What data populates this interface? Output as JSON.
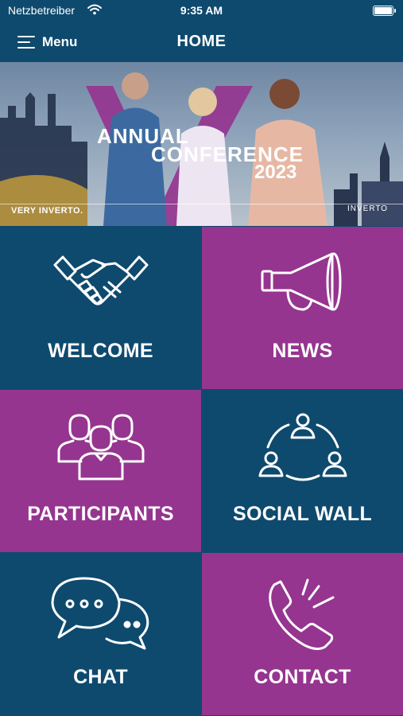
{
  "status_bar": {
    "carrier": "Netzbetreiber",
    "time": "9:35 AM"
  },
  "nav": {
    "menu_label": "Menu",
    "title": "HOME"
  },
  "banner": {
    "line1": "ANNUAL",
    "line2": "CONFERENCE",
    "line3": "2023",
    "tagline": "VERY INVERTO.",
    "brand": "INVERTO"
  },
  "tiles": [
    {
      "label": "WELCOME",
      "icon": "handshake-icon",
      "color": "#0e4a6e"
    },
    {
      "label": "NEWS",
      "icon": "megaphone-icon",
      "color": "#95358f"
    },
    {
      "label": "PARTICIPANTS",
      "icon": "participants-icon",
      "color": "#95358f"
    },
    {
      "label": "SOCIAL WALL",
      "icon": "network-icon",
      "color": "#0e4a6e"
    },
    {
      "label": "CHAT",
      "icon": "chat-bubbles-icon",
      "color": "#0e4a6e"
    },
    {
      "label": "CONTACT",
      "icon": "phone-icon",
      "color": "#95358f"
    }
  ],
  "colors": {
    "primary": "#0e4a6e",
    "accent": "#95358f"
  }
}
